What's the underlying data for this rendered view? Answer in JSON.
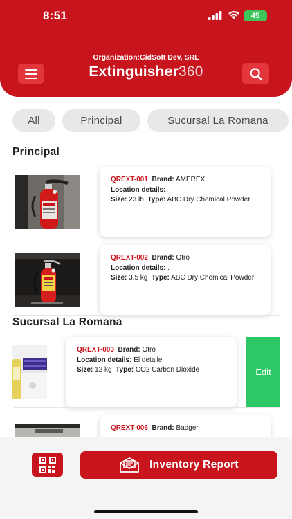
{
  "status": {
    "time": "8:51",
    "battery": "45"
  },
  "header": {
    "organization": "Organization:CidSoft Dev, SRL",
    "title_bold": "Extinguisher",
    "title_light": "360"
  },
  "filters": [
    {
      "label": "All"
    },
    {
      "label": "Principal"
    },
    {
      "label": "Sucursal La Romana"
    }
  ],
  "sections": [
    {
      "title": "Principal",
      "items": [
        {
          "code": "QREXT-001",
          "brand_label": "Brand:",
          "brand": "AMEREX",
          "location_label": "Location details:",
          "location": "",
          "size_label": "Size:",
          "size": "23 lb",
          "type_label": "Type:",
          "type": "ABC Dry Chemical Powder"
        },
        {
          "code": "QREXT-002",
          "brand_label": "Brand:",
          "brand": "Otro",
          "location_label": "Location details:",
          "location": ".",
          "size_label": "Size:",
          "size": "3.5 kg",
          "type_label": "Type:",
          "type": "ABC Dry Chemical Powder"
        }
      ]
    },
    {
      "title": "Sucursal La Romana",
      "items": [
        {
          "code": "QREXT-003",
          "brand_label": "Brand:",
          "brand": "Otro",
          "location_label": "Location details:",
          "location": "El detalle",
          "size_label": "Size:",
          "size": "12 kg",
          "type_label": "Type:",
          "type": "CO2 Carbon Dioxide",
          "swipe_action": "Edit"
        },
        {
          "code": "QREXT-006",
          "brand_label": "Brand:",
          "brand": "Badger"
        }
      ]
    }
  ],
  "bottom": {
    "report_label": "Inventory Report"
  },
  "colors": {
    "primary": "#c8141c",
    "edit": "#2cc766",
    "chip": "#e8e8e8"
  }
}
